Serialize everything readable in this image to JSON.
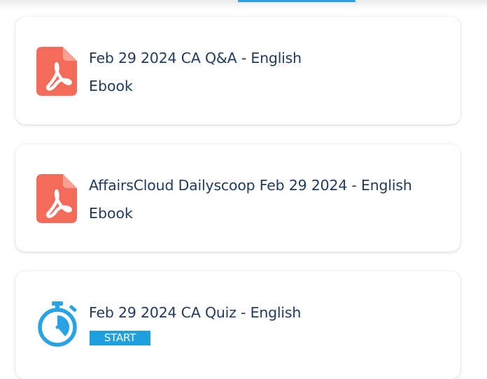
{
  "items": [
    {
      "title": "Feb 29 2024 CA Q&A - English",
      "subtitle": "Ebook",
      "icon": "pdf-file-icon",
      "icon_color": "#f26b5b"
    },
    {
      "title": "AffairsCloud Dailyscoop Feb 29 2024 - English",
      "subtitle": "Ebook",
      "icon": "pdf-file-icon",
      "icon_color": "#f26b5b"
    },
    {
      "title": "Feb 29 2024 CA Quiz - English",
      "button_label": "START",
      "icon": "stopwatch-icon",
      "icon_color": "#2aa3e4"
    }
  ],
  "colors": {
    "text": "#1f3a5b",
    "accent": "#1da0dd",
    "tab_indicator": "#2ea0e0"
  }
}
